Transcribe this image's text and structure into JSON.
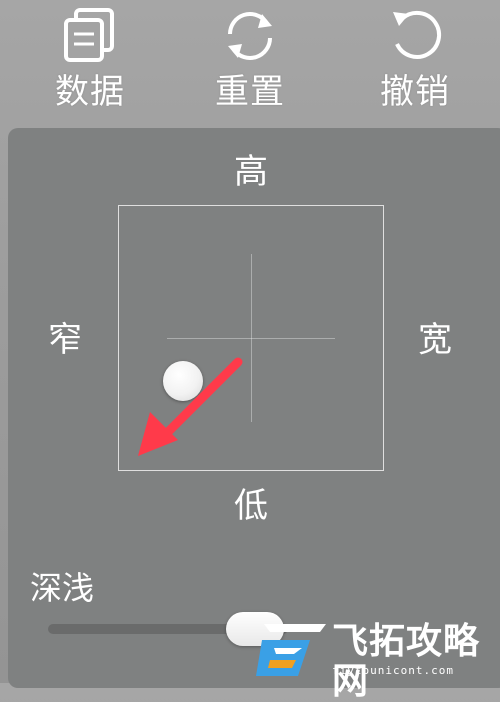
{
  "toolbar": {
    "data": {
      "label": "数据",
      "icon": "data-icon"
    },
    "reset": {
      "label": "重置",
      "icon": "reset-icon"
    },
    "undo": {
      "label": "撤销",
      "icon": "undo-icon"
    }
  },
  "pad": {
    "top_label": "高",
    "bottom_label": "低",
    "left_label": "窄",
    "right_label": "宽",
    "handle_icon": "position-handle"
  },
  "depth": {
    "label": "深浅",
    "value": 0.82
  },
  "annotation": {
    "arrow_color": "#ff3a4a"
  },
  "watermark": {
    "text": "飞拓攻略网",
    "sub": "fiytounicont.com"
  }
}
